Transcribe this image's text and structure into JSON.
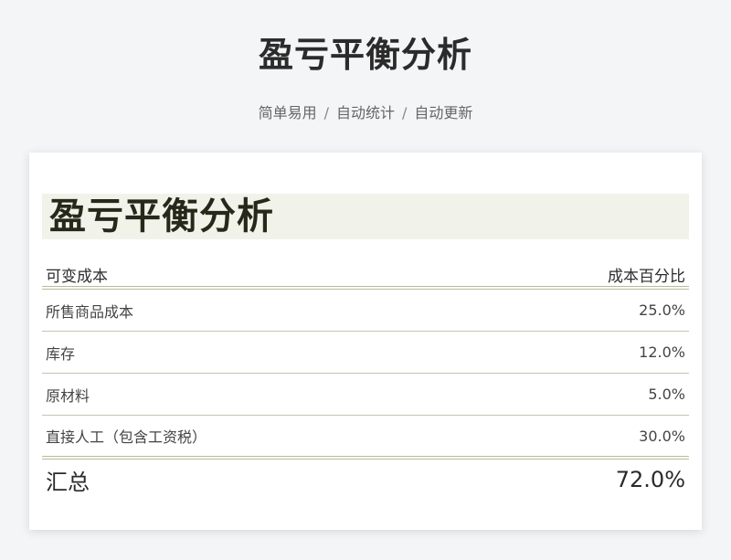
{
  "page": {
    "title": "盈亏平衡分析",
    "subtitle_parts": [
      "简单易用",
      "自动统计",
      "自动更新"
    ],
    "separator": "/"
  },
  "sheet": {
    "title": "盈亏平衡分析",
    "header": {
      "label": "可变成本",
      "value": "成本百分比"
    },
    "rows": [
      {
        "label": "所售商品成本",
        "value": "25.0%"
      },
      {
        "label": "库存",
        "value": "12.0%"
      },
      {
        "label": "原材料",
        "value": "5.0%"
      },
      {
        "label": "直接人工（包含工资税）",
        "value": "30.0%"
      }
    ],
    "total": {
      "label": "汇总",
      "value": "72.0%"
    }
  },
  "colors": {
    "background": "#f4f5f7",
    "sheet_header_band": "#f1f2ea",
    "rule": "#b9bc9a"
  }
}
